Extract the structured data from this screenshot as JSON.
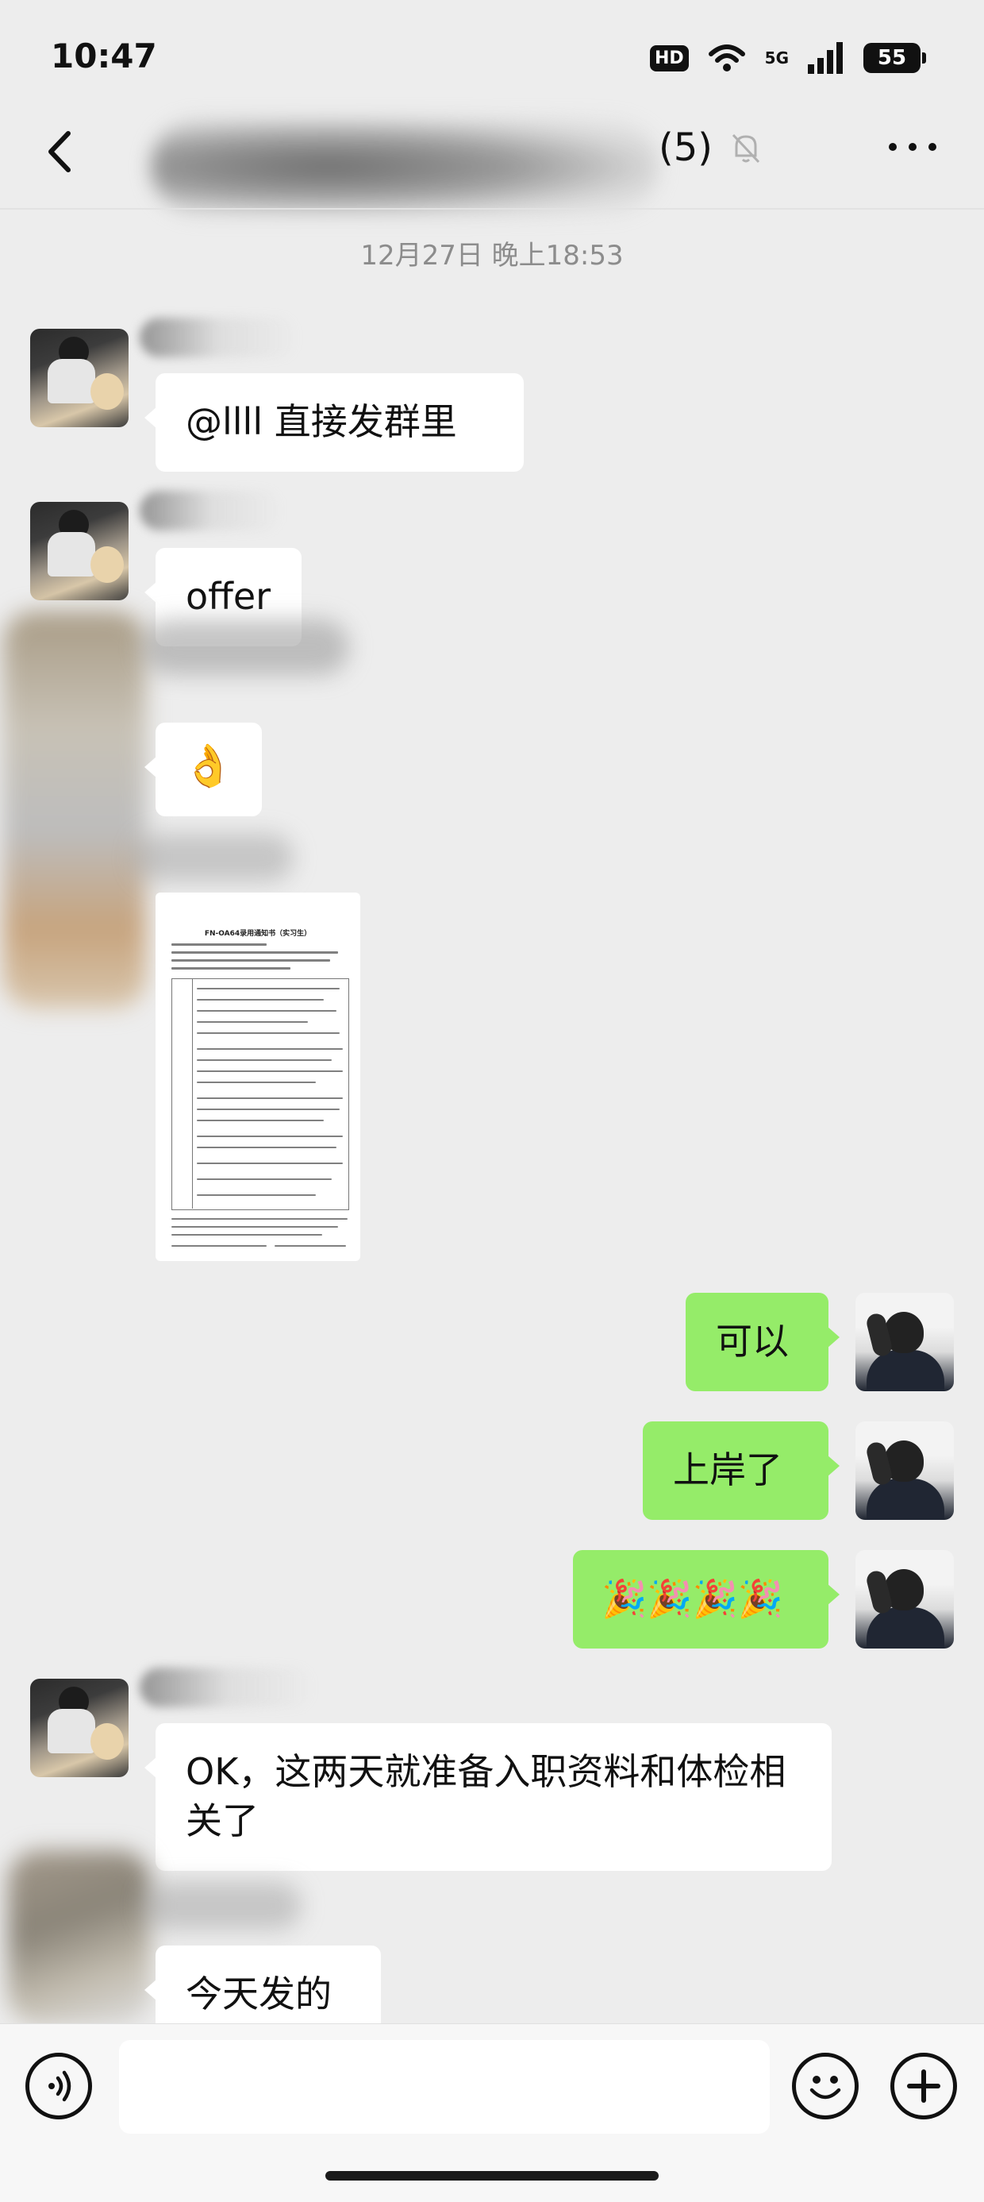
{
  "status_bar": {
    "time": "10:47",
    "hd_label": "HD",
    "network_label": "5G",
    "battery_level": "55"
  },
  "nav": {
    "member_count": "(5)"
  },
  "timestamp": "12月27日 晚上18:53",
  "messages": [
    {
      "side": "left",
      "type": "text",
      "text": "@llll  直接发群里"
    },
    {
      "side": "left",
      "type": "text",
      "text": "offer"
    },
    {
      "side": "left",
      "type": "emoji",
      "text": "👌"
    },
    {
      "side": "left",
      "type": "image",
      "doc_title": "FN-OA64录用通知书（实习生）"
    },
    {
      "side": "right",
      "type": "text",
      "text": "可以"
    },
    {
      "side": "right",
      "type": "text",
      "text": "上岸了"
    },
    {
      "side": "right",
      "type": "emoji",
      "text": "🎉🎉🎉🎉"
    },
    {
      "side": "left",
      "type": "text",
      "text": "OK，这两天就准备入职资料和体检相关了"
    },
    {
      "side": "left",
      "type": "text",
      "text": "今天发的"
    }
  ],
  "input": {
    "placeholder": ""
  },
  "colors": {
    "background": "#ededed",
    "sent_bubble": "#95ec69",
    "received_bubble": "#ffffff"
  },
  "icons": [
    "back-arrow-icon",
    "mute-bell-icon",
    "more-dots-icon",
    "voice-icon",
    "emoji-icon",
    "plus-icon",
    "wifi-icon",
    "signal-icon",
    "battery-icon"
  ]
}
